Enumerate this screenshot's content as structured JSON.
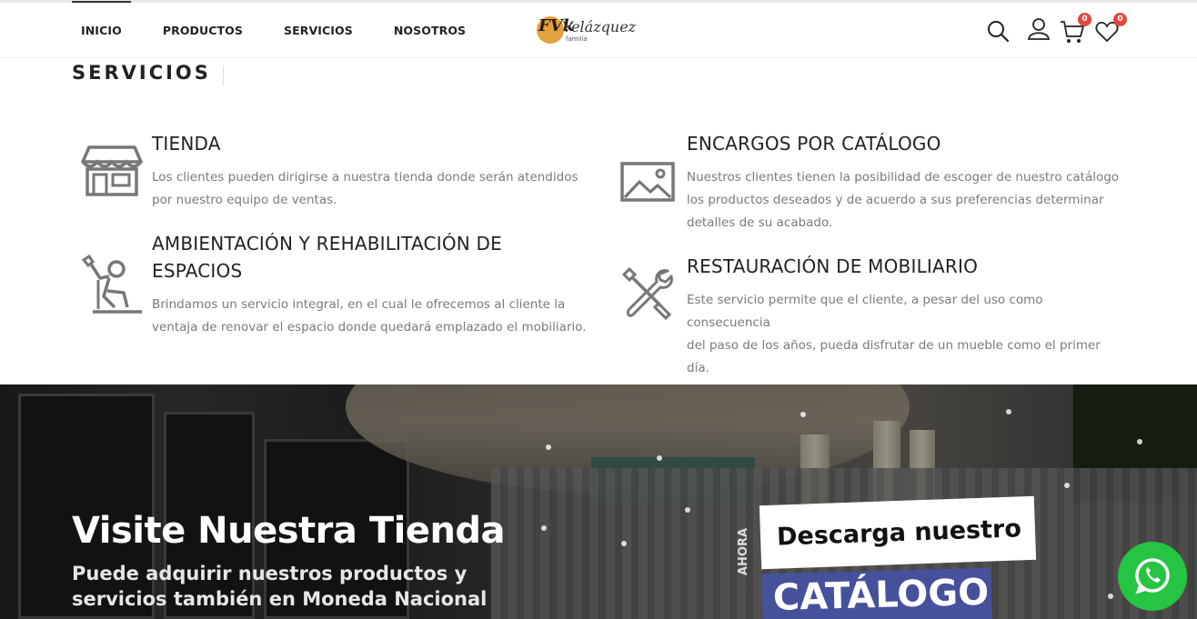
{
  "header": {
    "nav": [
      {
        "label": "INICIO",
        "active": true
      },
      {
        "label": "PRODUCTOS",
        "active": false
      },
      {
        "label": "SERVICIOS",
        "active": false
      },
      {
        "label": "NOSOTROS",
        "active": false
      }
    ],
    "logo": {
      "mark": "FVk",
      "name": "Velázquez",
      "sub": "familia"
    },
    "icons": [
      "search-icon",
      "user-icon",
      "cart-icon",
      "heart-icon"
    ],
    "cart_count": "0",
    "wishlist_count": "0",
    "badge_color": "#e2463d"
  },
  "services": {
    "title": "SERVICIOS",
    "items": [
      {
        "icon": "store-icon",
        "title": "TIENDA",
        "text_lines": [
          "Los clientes pueden dirigirse a nuestra tienda donde serán atendidos",
          "por nuestro equipo de ventas."
        ]
      },
      {
        "icon": "image-icon",
        "title": "ENCARGOS POR CATÁLOGO",
        "text_lines": [
          "Nuestros clientes tienen la posibilidad de escoger de nuestro catálogo",
          "los productos deseados y de acuerdo a sus preferencias determinar",
          "detalles de su acabado."
        ]
      },
      {
        "icon": "worker-icon",
        "title_lines": [
          "AMBIENTACIÓN Y REHABILITACIÓN DE",
          "ESPACIOS"
        ],
        "text_lines": [
          "Brindamos un servicio integral, en el cual le ofrecemos al cliente la",
          "ventaja de renovar el espacio donde quedará emplazado el mobiliario."
        ]
      },
      {
        "icon": "tools-icon",
        "title": "RESTAURACIÓN DE MOBILIARIO",
        "text_lines": [
          "Este servicio permite que el cliente, a pesar del uso como consecuencia",
          "del paso de los años, pueda disfrutar de un mueble como el primer día."
        ]
      }
    ]
  },
  "banner": {
    "title": "Visite Nuestra Tienda",
    "subtitle_lines": [
      "Puede adquirir nuestros productos y",
      "servicios también en Moneda Nacional"
    ],
    "catalog_top": "Descarga nuestro",
    "catalog_side": "AHORA",
    "catalog_main": "CATÁLOGO",
    "catalog_color": "#45519b"
  },
  "whatsapp": {
    "icon": "whatsapp-icon",
    "color": "#25c442"
  }
}
